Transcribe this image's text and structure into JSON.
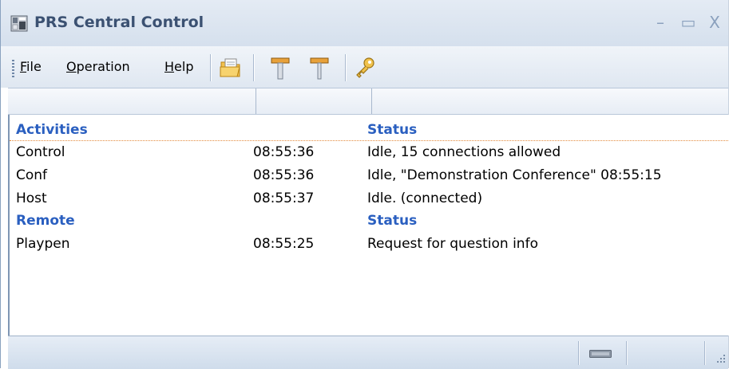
{
  "window": {
    "title": "PRS Central Control",
    "controls": {
      "minimize": "–",
      "maximize": "▭",
      "close": "X"
    }
  },
  "menu": {
    "file_pre": "",
    "file_ul": "F",
    "file_post": "ile",
    "operation_pre": "",
    "operation_ul": "O",
    "operation_post": "peration",
    "help_pre": "",
    "help_ul": "H",
    "help_post": "elp"
  },
  "toolbar": {
    "icons": [
      "open-folder-icon",
      "connect-icon",
      "disconnect-icon",
      "key-icon"
    ]
  },
  "list": {
    "activities_header": {
      "name": "Activities",
      "status": "Status"
    },
    "activities": [
      {
        "name": "Control",
        "time": "08:55:36",
        "status": "Idle, 15 connections allowed"
      },
      {
        "name": "Conf",
        "time": "08:55:36",
        "status": "Idle, \"Demonstration Conference\" 08:55:15"
      },
      {
        "name": "Host",
        "time": "08:55:37",
        "status": "Idle. (connected)"
      }
    ],
    "remote_header": {
      "name": "Remote",
      "status": "Status"
    },
    "remote": [
      {
        "name": "Playpen",
        "time": "08:55:25",
        "status": "Request for question info"
      }
    ]
  },
  "colors": {
    "group_header": "#2a5fc0",
    "title_text": "#3b5172",
    "accent_dotted": "#e38a3c"
  }
}
